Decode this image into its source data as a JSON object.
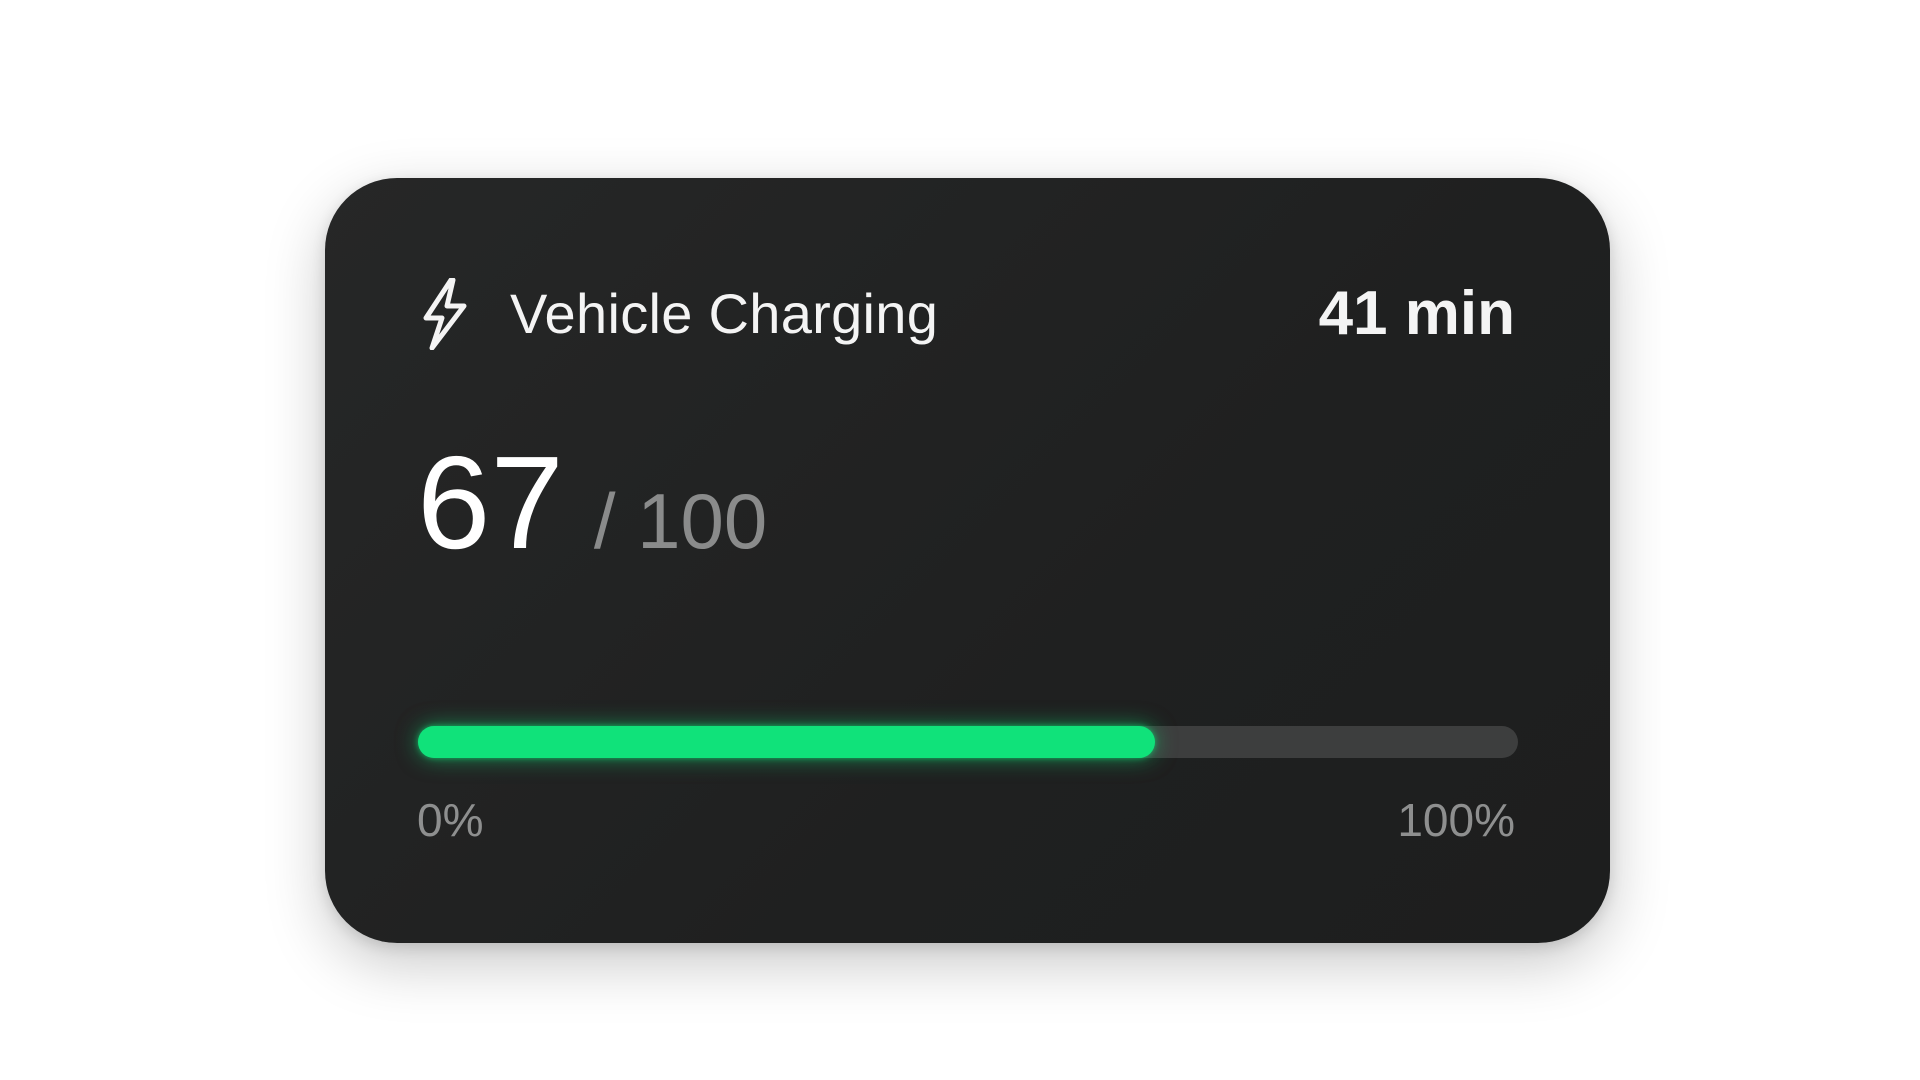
{
  "widget": {
    "icon": "lightning-bolt-icon",
    "title": "Vehicle Charging",
    "time_remaining": "41 min",
    "charge_value": "67",
    "charge_max": "/ 100",
    "progress_fraction": 0.67,
    "scale_min_label": "0%",
    "scale_max_label": "100%",
    "colors": {
      "card_background": "#222323",
      "progress_fill": "#10e27a",
      "progress_track": "#3d3e3e",
      "primary_text": "#f4f4f4",
      "secondary_text": "#8a8b8b"
    }
  }
}
